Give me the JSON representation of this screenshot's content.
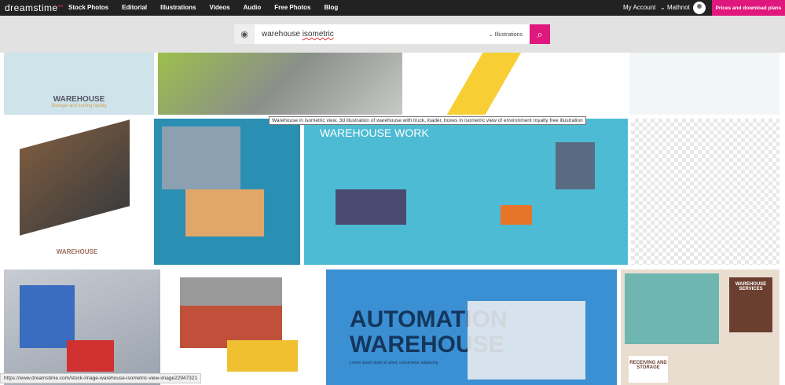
{
  "nav": {
    "logo": "dreamstime",
    "links": [
      "Stock Photos",
      "Editorial",
      "Illustrations",
      "Videos",
      "Audio",
      "Free Photos",
      "Blog"
    ],
    "my_account": "My Account",
    "user": "Mathnot",
    "plans": "Prices and download plans"
  },
  "search": {
    "query_1": "warehouse",
    "query_2": "isometric",
    "category": "Illustrations"
  },
  "tiles": {
    "t1_title": "WAREHOUSE",
    "t1_sub": "Storage and sorting facility",
    "t5_title": "WAREHOUSE",
    "t7_title": "WAREHOUSE WORK",
    "t11_title": "AUTOMATION WAREHOUSE",
    "t11_body": "Lorem ipsum dolor sit amet, consectetur adipiscing",
    "t12_services": "WAREHOUSE SERVICES",
    "t12_receiving": "RECEIVING AND STORAGE"
  },
  "tooltip": "Warehouse in isometric view. 3d illustration of warehouse with truck, loader, boxes in isometric view of environment royalty free illustration",
  "status_url": "https://www.dreamstime.com/stock-image-warehouse-isometric-view-image22947321",
  "colors": {
    "brand": "#e0177d",
    "nav_bg": "#222222"
  }
}
